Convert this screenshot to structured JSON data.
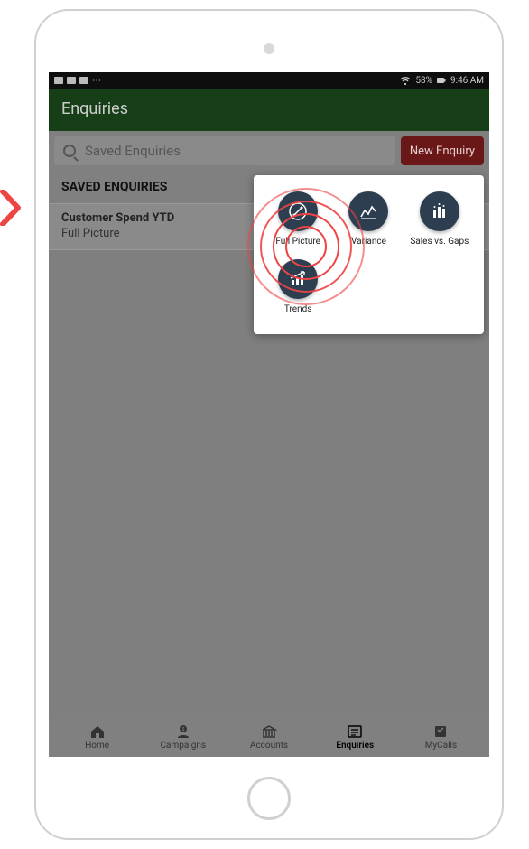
{
  "status": {
    "battery_pct": "58%",
    "time": "9:46 AM"
  },
  "header": {
    "title": "Enquiries"
  },
  "search": {
    "placeholder": "Saved Enquiries"
  },
  "buttons": {
    "new_enquiry": "New Enquiry"
  },
  "section": {
    "saved_title": "SAVED ENQUIRIES"
  },
  "saved_items": [
    {
      "title": "Customer Spend YTD",
      "subtitle": "Full Picture"
    }
  ],
  "popup": {
    "items": [
      {
        "key": "full_picture",
        "label": "Full Picture"
      },
      {
        "key": "variance",
        "label": "Variance"
      },
      {
        "key": "sales_vs_gaps",
        "label": "Sales vs. Gaps"
      },
      {
        "key": "trends",
        "label": "Trends"
      }
    ]
  },
  "nav": {
    "items": [
      {
        "key": "home",
        "label": "Home"
      },
      {
        "key": "campaigns",
        "label": "Campaigns"
      },
      {
        "key": "accounts",
        "label": "Accounts"
      },
      {
        "key": "enquiries",
        "label": "Enquiries",
        "active": true
      },
      {
        "key": "mycalls",
        "label": "MyCalls"
      }
    ]
  }
}
